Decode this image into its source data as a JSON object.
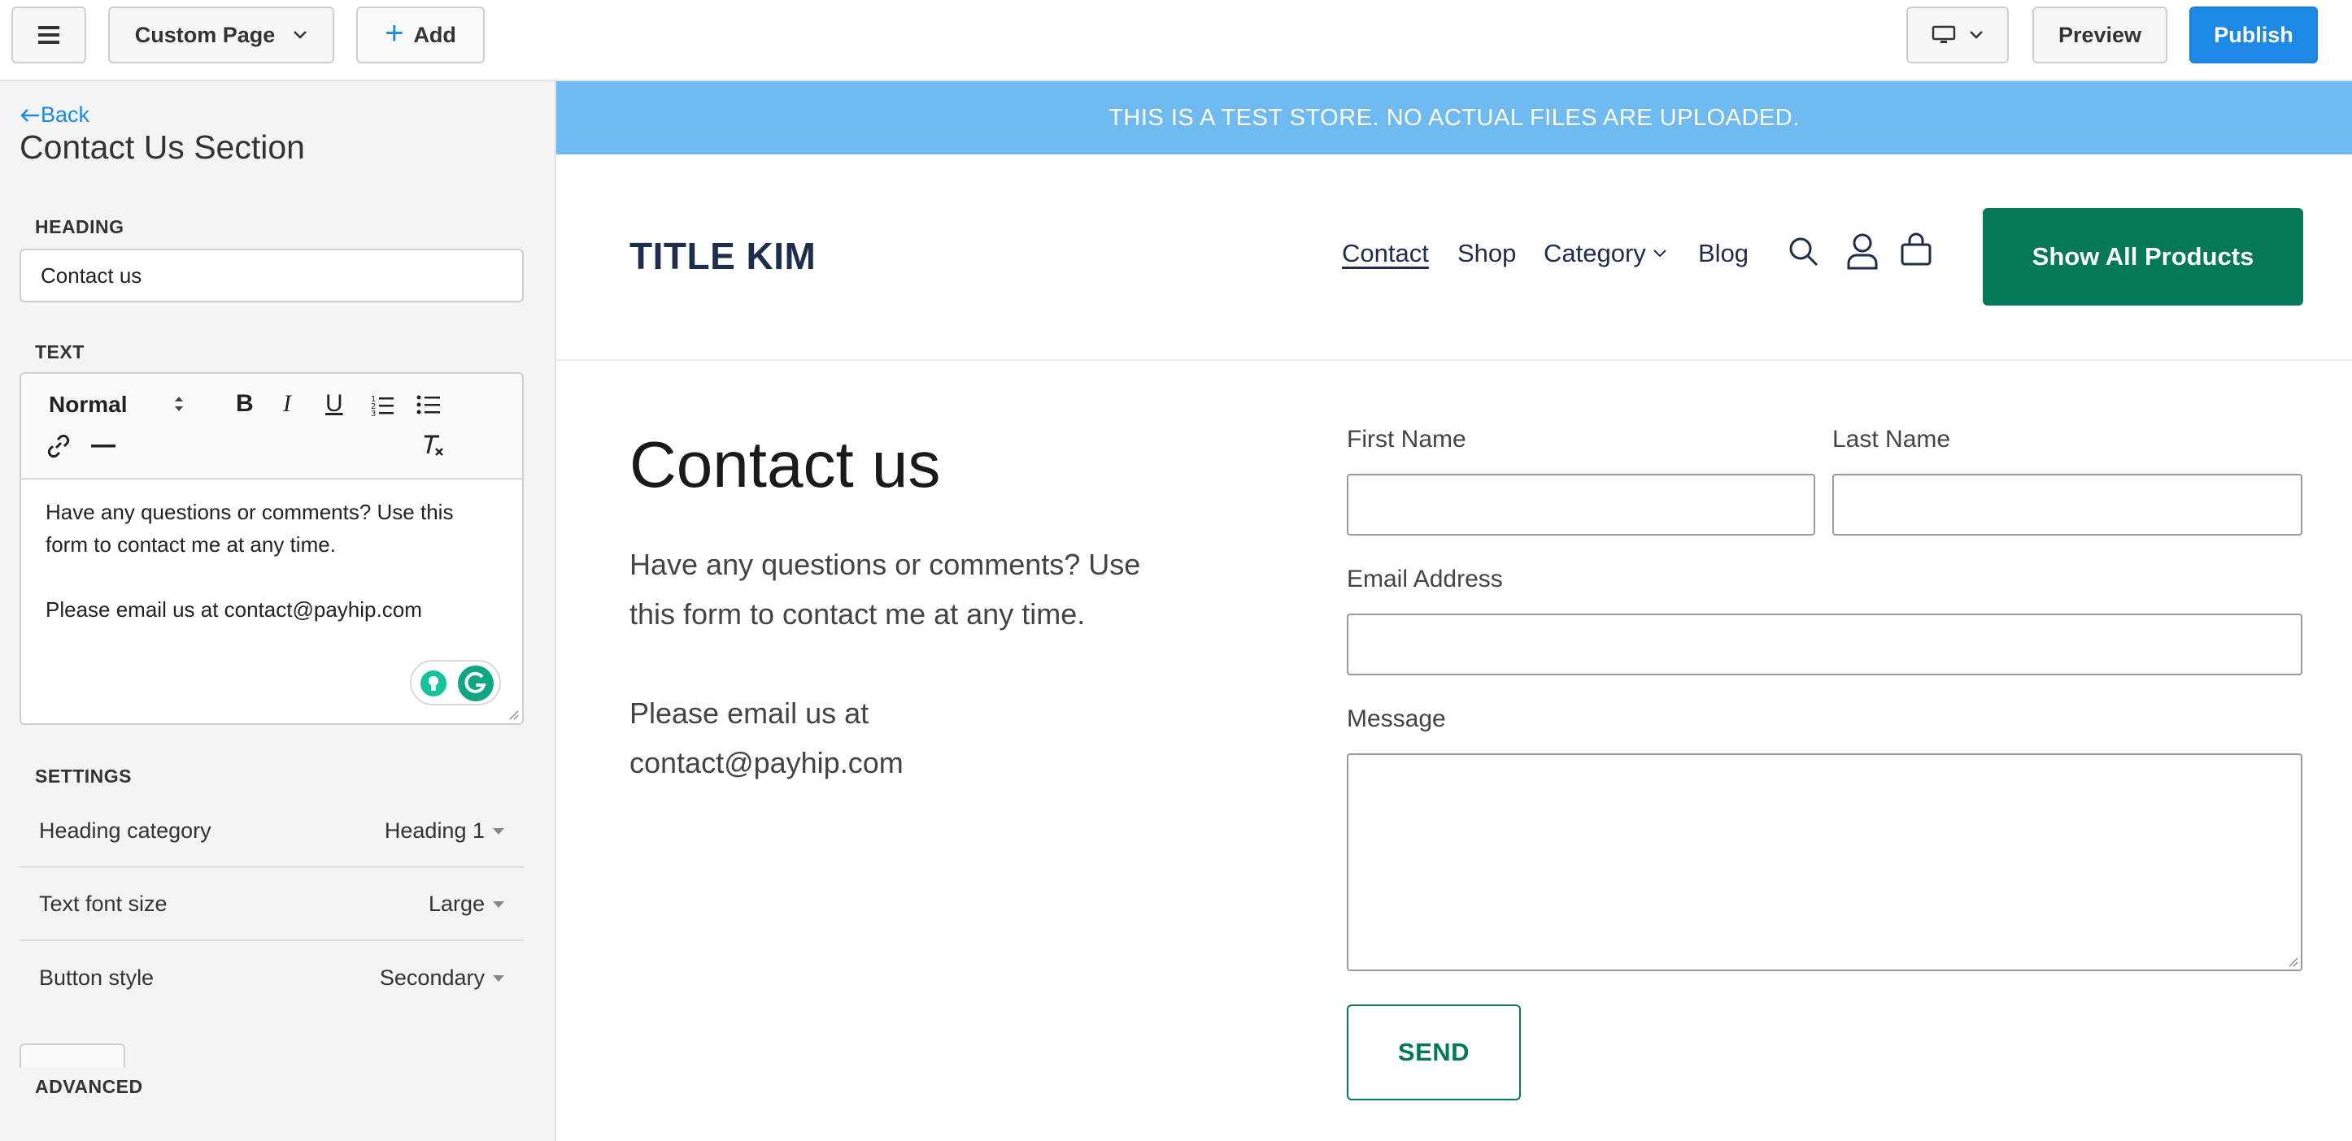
{
  "toolbar": {
    "page_select": "Custom Page",
    "add_label": "Add",
    "preview_label": "Preview",
    "publish_label": "Publish"
  },
  "sidebar": {
    "back_label": "Back",
    "title": "Contact Us Section",
    "heading_label": "HEADING",
    "heading_value": "Contact us",
    "text_label": "TEXT",
    "editor": {
      "format": "Normal",
      "paragraphs": [
        "Have any questions or comments? Use this form to contact me at any time.",
        "Please email us at contact@payhip.com"
      ]
    },
    "settings_label": "SETTINGS",
    "settings": [
      {
        "label": "Heading category",
        "value": "Heading 1"
      },
      {
        "label": "Text font size",
        "value": "Large"
      },
      {
        "label": "Button style",
        "value": "Secondary"
      }
    ],
    "advanced_label": "ADVANCED"
  },
  "preview": {
    "banner": "THIS IS A TEST STORE. NO ACTUAL FILES ARE UPLOADED.",
    "store_title": "TITLE KIM",
    "nav": [
      "Contact",
      "Shop",
      "Category",
      "Blog"
    ],
    "cta_label": "Show All Products",
    "heading": "Contact us",
    "paragraphs": [
      "Have any questions or comments? Use this form to contact me at any time.",
      "Please email us at contact@payhip.com"
    ],
    "form": {
      "first_name_label": "First Name",
      "last_name_label": "Last Name",
      "email_label": "Email Address",
      "message_label": "Message",
      "send_label": "SEND"
    }
  },
  "colors": {
    "accent_blue": "#1e88e5",
    "banner_blue": "#6fbaf0",
    "brand_green": "#047857",
    "navy": "#1e2d4a"
  },
  "icons": [
    "hamburger-menu-icon",
    "chevron-down-icon",
    "plus-icon",
    "desktop-icon",
    "arrow-left-icon",
    "bold-icon",
    "italic-icon",
    "underline-icon",
    "ordered-list-icon",
    "bullet-list-icon",
    "link-icon",
    "horizontal-rule-icon",
    "clear-format-icon",
    "grammarly-icon",
    "search-icon",
    "user-icon",
    "cart-icon"
  ]
}
